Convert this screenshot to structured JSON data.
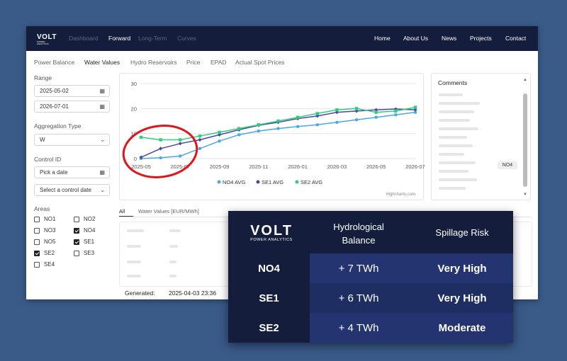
{
  "nav": {
    "brand": "VOLT",
    "brand_sub": "POWER ANALYTICS",
    "left": [
      "Dashboard",
      "Forward",
      "Long-Term",
      "Curves"
    ],
    "right": [
      "Home",
      "About Us",
      "News",
      "Projects",
      "Contact"
    ]
  },
  "tabs": [
    "Power Balance",
    "Water Values",
    "Hydro Reservoirs",
    "Price",
    "EPAD",
    "Actual Spot Prices"
  ],
  "sidebar": {
    "range_label": "Range",
    "range_start": "2025-05-02",
    "range_end": "2026-07-01",
    "aggregation_label": "Aggregation Type",
    "aggregation_value": "W",
    "control_id_label": "Control ID",
    "pick_date_placeholder": "Pick a date",
    "select_control_placeholder": "Select a control date",
    "areas_label": "Areas",
    "areas": [
      {
        "name": "NO1",
        "checked": false
      },
      {
        "name": "NO2",
        "checked": false
      },
      {
        "name": "NO3",
        "checked": false
      },
      {
        "name": "NO4",
        "checked": true
      },
      {
        "name": "NO5",
        "checked": false
      },
      {
        "name": "SE1",
        "checked": true
      },
      {
        "name": "SE2",
        "checked": true
      },
      {
        "name": "SE3",
        "checked": false
      },
      {
        "name": "SE4",
        "checked": false
      }
    ]
  },
  "comments": {
    "title": "Comments",
    "badge": "NO4"
  },
  "lower_tabs": {
    "all": "All",
    "water_values": "Water Values [EUR/MWh]"
  },
  "generated": {
    "label": "Generated:",
    "value": "2025-04-03 23:36"
  },
  "chart_data": {
    "type": "line",
    "ylim": [
      0,
      30
    ],
    "yticks": [
      0,
      10,
      20,
      30
    ],
    "xticks": [
      "2025-05",
      "2025-07",
      "2025-09",
      "2025-11",
      "2026-01",
      "2026-03",
      "2026-05",
      "2026-07"
    ],
    "x": [
      "2025-05",
      "2025-06",
      "2025-07",
      "2025-08",
      "2025-09",
      "2025-10",
      "2025-11",
      "2025-12",
      "2026-01",
      "2026-02",
      "2026-03",
      "2026-04",
      "2026-05",
      "2026-06",
      "2026-07"
    ],
    "series": [
      {
        "name": "NO4 AVG",
        "color": "#4aa8e8",
        "values": [
          0,
          0.3,
          1,
          4,
          7,
          9.5,
          11,
          12,
          12.8,
          13.5,
          14.5,
          15.5,
          16.5,
          17.5,
          18.5
        ]
      },
      {
        "name": "SE1 AVG",
        "color": "#4f46a8",
        "values": [
          0.5,
          4,
          6,
          7.5,
          9.5,
          11.5,
          13.3,
          14.5,
          16,
          17,
          18.5,
          19,
          19.5,
          19.8,
          19.5
        ]
      },
      {
        "name": "SE2 AVG",
        "color": "#2ecf7a",
        "values": [
          8.5,
          7.5,
          7.5,
          9,
          10.5,
          12,
          13.5,
          15,
          16.5,
          18,
          19.5,
          20,
          18.5,
          19,
          20.5
        ]
      }
    ],
    "credit": "Highcharts.com",
    "annotation": "red-circle-around-2025-05-start"
  },
  "overlay": {
    "logo_text": "VOLT",
    "logo_sub": "POWER ANALYTICS",
    "col1": "Hydrological Balance",
    "col2": "Spillage Risk",
    "rows": [
      {
        "area": "NO4",
        "balance": "+ 7 TWh",
        "risk": "Very High"
      },
      {
        "area": "SE1",
        "balance": "+ 6 TWh",
        "risk": "Very High"
      },
      {
        "area": "SE2",
        "balance": "+ 4 TWh",
        "risk": "Moderate"
      }
    ]
  }
}
